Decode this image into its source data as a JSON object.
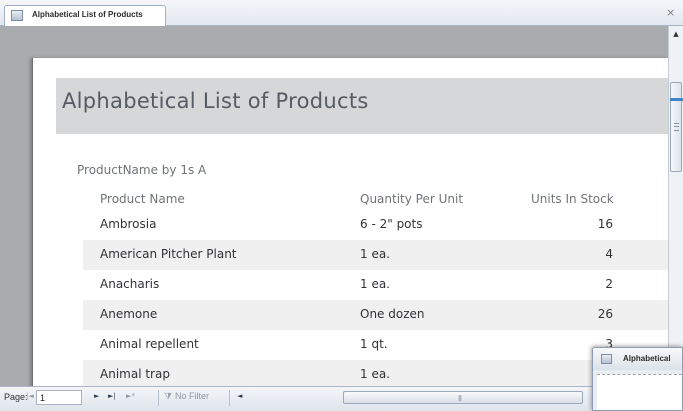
{
  "window": {
    "tab_title": "Alphabetical List of Products",
    "close_glyph": "×",
    "icon": "report-icon"
  },
  "report": {
    "title": "Alphabetical List of Products",
    "group_header": "ProductName by 1s  A",
    "columns": {
      "name": "Product Name",
      "qty": "Quantity Per Unit",
      "stock": "Units In Stock"
    },
    "rows": [
      {
        "name": "Ambrosia",
        "qty": "6 - 2\" pots",
        "stock": "16"
      },
      {
        "name": "American Pitcher Plant",
        "qty": "1 ea.",
        "stock": "4"
      },
      {
        "name": "Anacharis",
        "qty": "1 ea.",
        "stock": "2"
      },
      {
        "name": "Anemone",
        "qty": "One dozen",
        "stock": "26"
      },
      {
        "name": "Animal repellent",
        "qty": "1 qt.",
        "stock": "3"
      },
      {
        "name": "Animal trap",
        "qty": "1 ea.",
        "stock": ""
      }
    ]
  },
  "navigation": {
    "page_label": "Page:",
    "page_value": "1",
    "first_glyph": "|◄",
    "prev_glyph": "◄",
    "next_glyph": "►",
    "last_glyph": "►|",
    "new_glyph": "►*",
    "filter_label": "No Filter",
    "scroll_left_glyph": "◄",
    "scroll_grip": "|||"
  },
  "second_window": {
    "title": "Alphabetical"
  },
  "colors": {
    "title_band": "#d6d7d9",
    "shaded_row": "#f0f0f0",
    "preview_background": "#a9abae",
    "accent_blue": "#3e86c9"
  }
}
